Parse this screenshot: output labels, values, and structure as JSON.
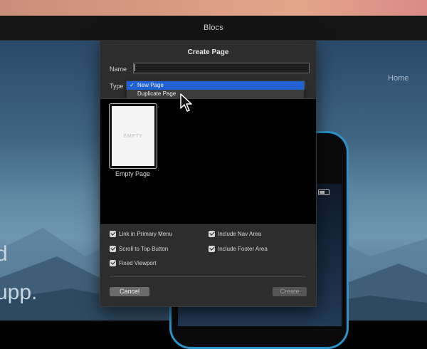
{
  "app": {
    "title": "Blocs"
  },
  "canvas": {
    "nav_home": "Home",
    "hero_fragment_1": "d",
    "hero_fragment_2": "upp."
  },
  "dialog": {
    "title": "Create Page",
    "name_label": "Name",
    "name_value": "",
    "type_label": "Type",
    "type_options": [
      {
        "label": "New Page",
        "selected": true
      },
      {
        "label": "Duplicate Page",
        "selected": false
      }
    ],
    "templates": [
      {
        "thumb_text": "EMPTY",
        "name": "Empty Page"
      }
    ],
    "options": {
      "link_primary_menu": {
        "label": "Link in Primary Menu",
        "checked": true
      },
      "scroll_top": {
        "label": "Scroll to Top Button",
        "checked": true
      },
      "fixed_viewport": {
        "label": "Fixed Viewport",
        "checked": true
      },
      "include_nav": {
        "label": "Include Nav Area",
        "checked": true
      },
      "include_footer": {
        "label": "Include Footer Area",
        "checked": true
      }
    },
    "cancel_label": "Cancel",
    "create_label": "Create"
  },
  "colors": {
    "accent": "#1e62d4",
    "dialog_bg": "#2d2d2d",
    "phone_border": "#2c93c9"
  }
}
